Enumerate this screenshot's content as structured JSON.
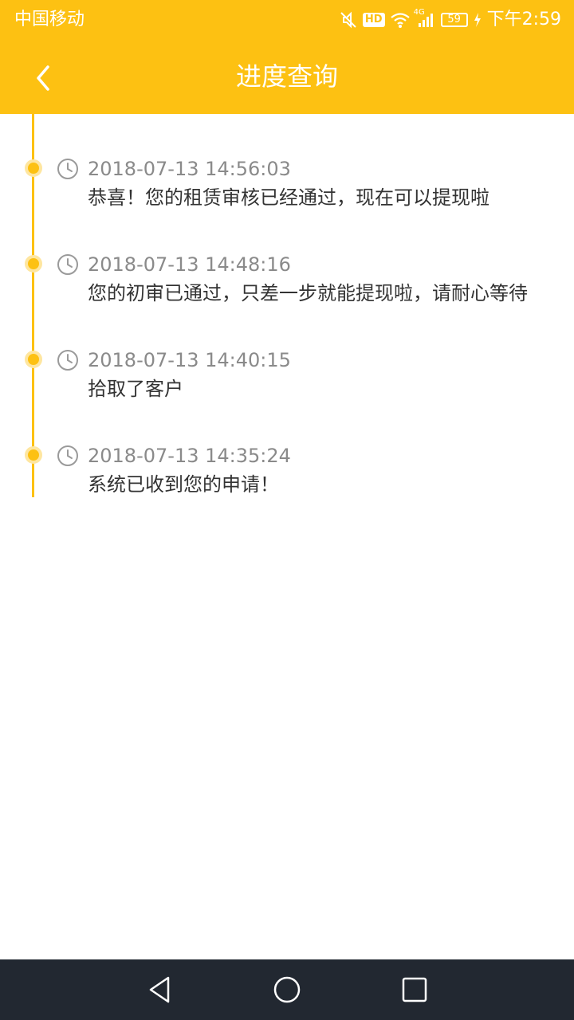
{
  "status_bar": {
    "carrier": "中国移动",
    "hd": "HD",
    "network": "4G",
    "battery": "59",
    "time": "下午2:59"
  },
  "header": {
    "title": "进度查询"
  },
  "timeline": [
    {
      "time": "2018-07-13 14:56:03",
      "text": "恭喜！您的租赁审核已经通过，现在可以提现啦"
    },
    {
      "time": "2018-07-13 14:48:16",
      "text": "您的初审已通过，只差一步就能提现啦，请耐心等待"
    },
    {
      "time": "2018-07-13 14:40:15",
      "text": "拾取了客户"
    },
    {
      "time": "2018-07-13 14:35:24",
      "text": "系统已收到您的申请！"
    }
  ],
  "icons": {
    "back": "chevron-left-icon",
    "clock": "clock-icon",
    "nav_back": "triangle-back-icon",
    "nav_home": "circle-home-icon",
    "nav_recent": "square-recent-icon"
  },
  "colors": {
    "accent": "#FDC112",
    "nav_bar": "#222831"
  }
}
